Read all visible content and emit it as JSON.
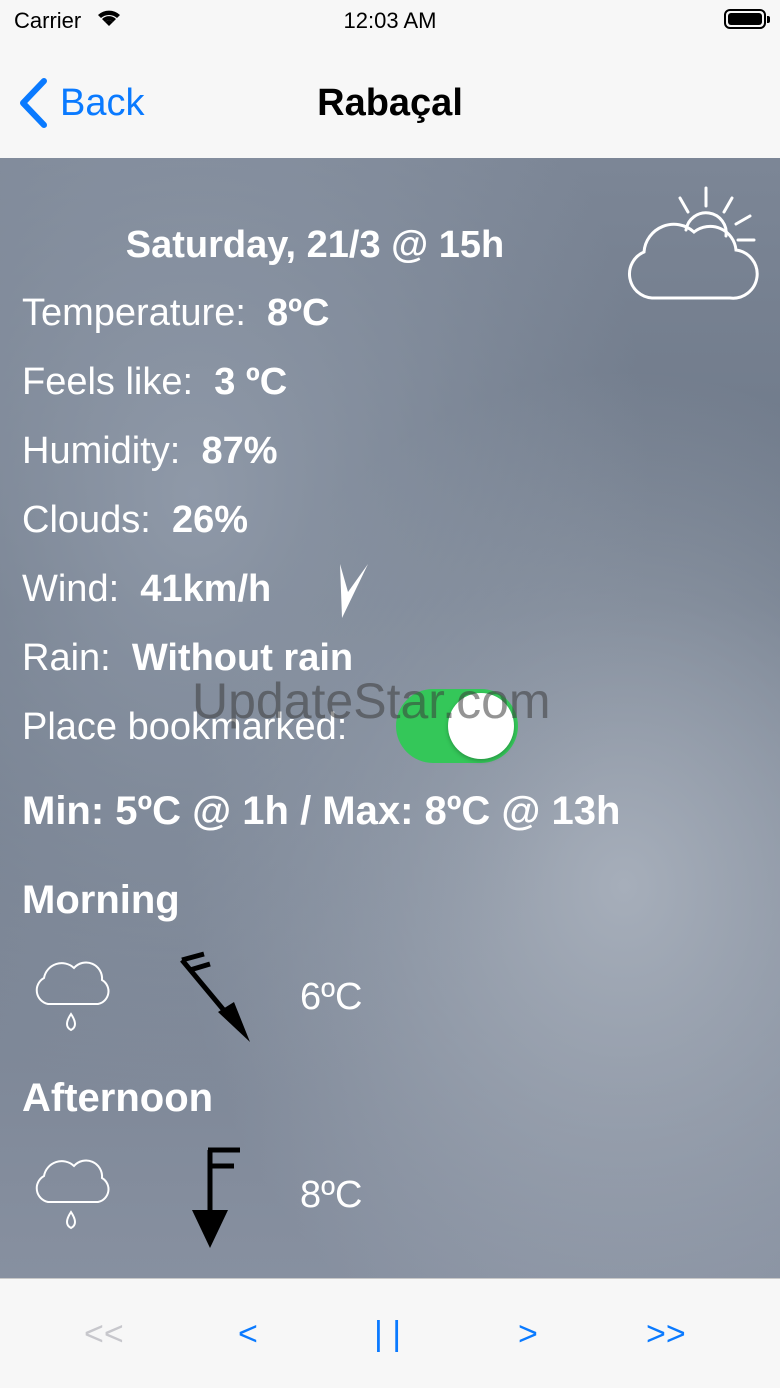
{
  "status_bar": {
    "carrier": "Carrier",
    "time": "12:03 AM"
  },
  "nav": {
    "back_label": "Back",
    "title": "Rabaçal"
  },
  "weather": {
    "date": "Saturday, 21/3 @ 15h",
    "temperature_label": "Temperature:",
    "temperature_value": "8ºC",
    "feels_like_label": "Feels like:",
    "feels_like_value": "3 ºC",
    "humidity_label": "Humidity:",
    "humidity_value": "87%",
    "clouds_label": "Clouds:",
    "clouds_value": "26%",
    "wind_label": "Wind:",
    "wind_value": "41km/h",
    "rain_label": "Rain:",
    "rain_value": "Without rain",
    "bookmarked_label": "Place bookmarked:",
    "bookmarked": true,
    "min_max": "Min: 5ºC @ 1h / Max: 8ºC @ 13h",
    "current_icon": "partly-cloudy-icon"
  },
  "periods": [
    {
      "name": "Morning",
      "icon": "rain-cloud-icon",
      "wind_icon": "wind-arrow-icon",
      "temperature": "6ºC"
    },
    {
      "name": "Afternoon",
      "icon": "rain-cloud-icon",
      "wind_icon": "wind-arrow-icon",
      "temperature": "8ºC"
    }
  ],
  "watermark": "UpdateStar.com",
  "toolbar": {
    "first": "<<",
    "prev": "<",
    "pause": "| |",
    "next": ">",
    "last": ">>"
  },
  "colors": {
    "accent": "#0a7aff",
    "toggle_on": "#34c759",
    "disabled": "#c7c7cc"
  }
}
